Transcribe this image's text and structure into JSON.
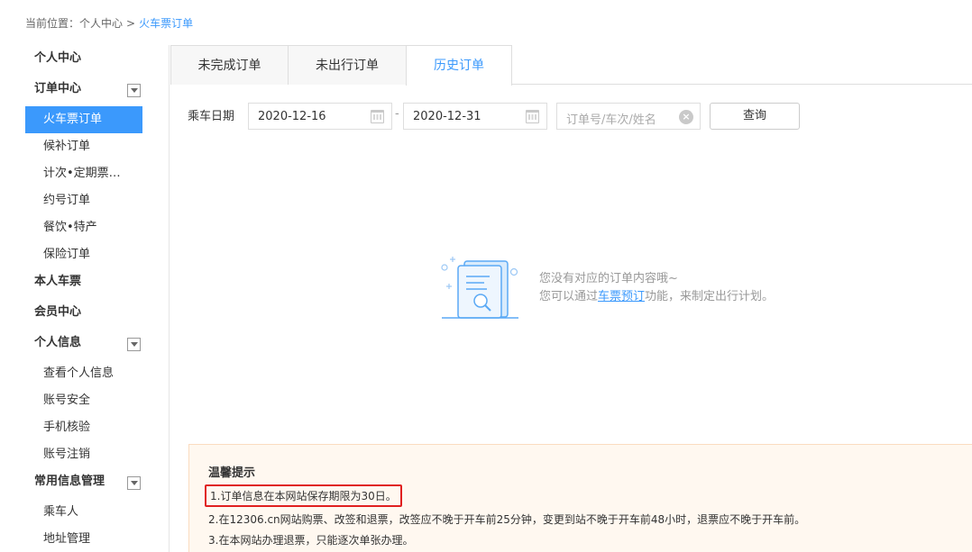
{
  "breadcrumb": {
    "prefix": "当前位置：",
    "home": "个人中心",
    "separator": ">",
    "current": "火车票订单"
  },
  "sidebar": {
    "personal_center": "个人中心",
    "order_center": {
      "label": "订单中心",
      "items": [
        "火车票订单",
        "候补订单",
        "计次•定期票…",
        "约号订单",
        "餐饮•特产",
        "保险订单"
      ]
    },
    "my_tickets": "本人车票",
    "member_center": "会员中心",
    "personal_info": {
      "label": "个人信息",
      "items": [
        "查看个人信息",
        "账号安全",
        "手机核验",
        "账号注销"
      ]
    },
    "common_info": {
      "label": "常用信息管理",
      "items": [
        "乘车人",
        "地址管理"
      ]
    }
  },
  "tabs": [
    "未完成订单",
    "未出行订单",
    "历史订单"
  ],
  "query": {
    "date_label": "乘车日期",
    "start_date": "2020-12-16",
    "date_separator": "-",
    "end_date": "2020-12-31",
    "search_placeholder": "订单号/车次/姓名",
    "button": "查询"
  },
  "empty": {
    "line1": "您没有对应的订单内容哦~",
    "line2_prefix": "您可以通过",
    "line2_link": "车票预订",
    "line2_suffix": "功能，来制定出行计划。"
  },
  "tips": {
    "title": "温馨提示",
    "items": [
      "1.订单信息在本网站保存期限为30日。",
      "2.在12306.cn网站购票、改签和退票，改签应不晚于开车前25分钟，变更到站不晚于开车前48小时，退票应不晚于开车前。",
      "3.在本网站办理退票，只能逐次单张办理。"
    ]
  },
  "colors": {
    "accent": "#3b99fc",
    "highlight_border": "#e02020",
    "tips_bg": "#fff8f0"
  }
}
